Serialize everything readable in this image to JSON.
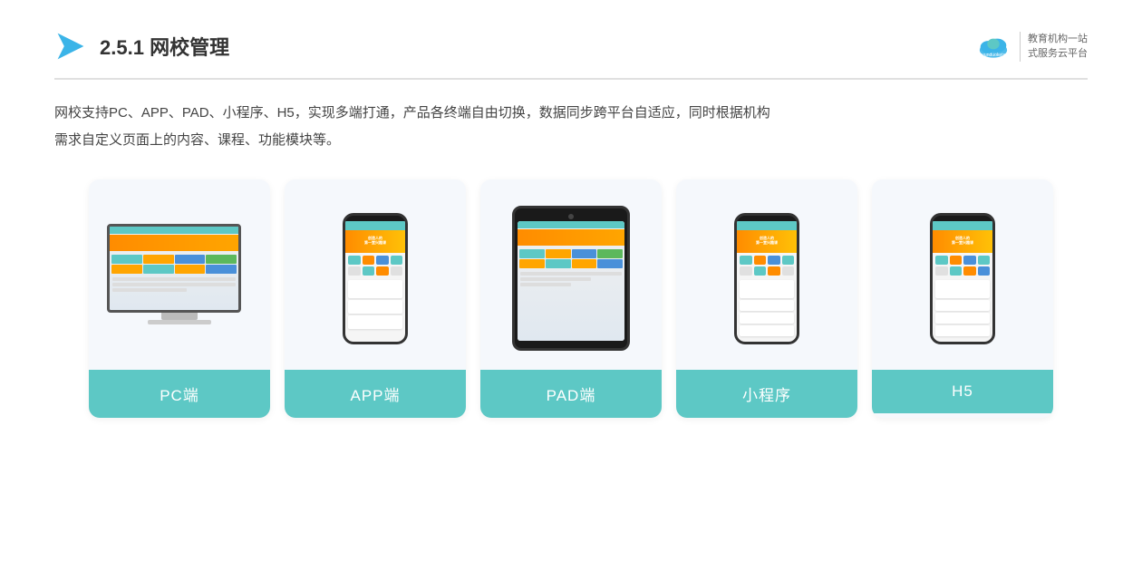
{
  "header": {
    "section_number": "2.5.1",
    "title": "网校管理",
    "brand_name": "云朵课堂",
    "brand_site": "yunduoketang.com",
    "brand_tagline1": "教育机构一站",
    "brand_tagline2": "式服务云平台"
  },
  "description": {
    "line1": "网校支持PC、APP、PAD、小程序、H5，实现多端打通，产品各终端自由切换，数据同步跨平台自适应，同时根据机构",
    "line2": "需求自定义页面上的内容、课程、功能模块等。"
  },
  "cards": [
    {
      "id": "pc",
      "label": "PC端"
    },
    {
      "id": "app",
      "label": "APP端"
    },
    {
      "id": "pad",
      "label": "PAD端"
    },
    {
      "id": "miniprogram",
      "label": "小程序"
    },
    {
      "id": "h5",
      "label": "H5"
    }
  ]
}
